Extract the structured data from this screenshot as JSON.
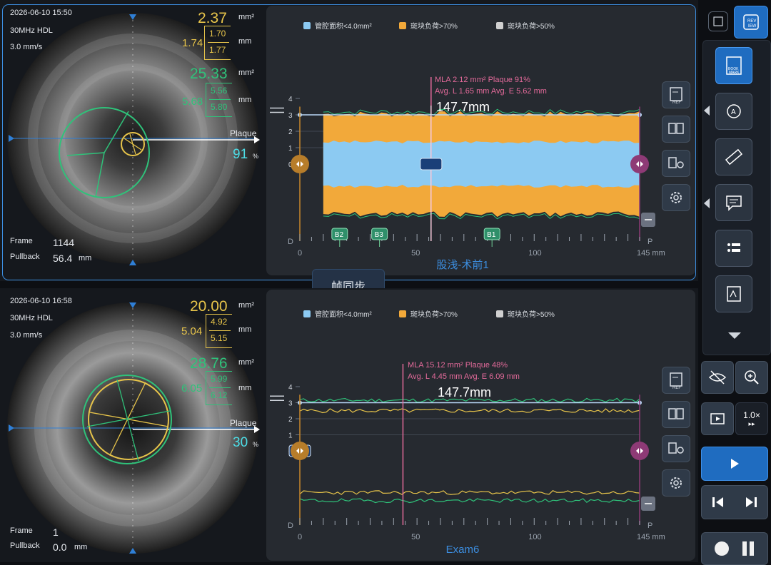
{
  "top": {
    "datetime": "2026-06-10 15:50",
    "probe": "30MHz HDL",
    "speed": "3.0 mm/s",
    "area1": "2.37",
    "area1_unit": "mm²",
    "diam1_main": "1.74",
    "diam1_top": "1.70",
    "diam1_bottom": "1.77",
    "diam1_unit": "mm",
    "area2": "25.33",
    "area2_unit": "mm²",
    "diam2_main": "5.68",
    "diam2_top": "5.56",
    "diam2_bottom": "5.80",
    "diam2_unit": "mm",
    "plaque_label": "Plaque",
    "plaque_value": "91",
    "plaque_unit": "%",
    "frame_label": "Frame",
    "frame_value": "1144",
    "pullback_label": "Pullback",
    "pullback_value": "56.4",
    "pullback_unit": "mm",
    "mla_line1": "MLA 2.12 mm²  Plaque 91%",
    "mla_line2": "Avg. L 1.65 mm  Avg. E 5.62 mm",
    "measure": "147.7mm",
    "exam_name": "股浅-术前1",
    "bookmarks": [
      "B2",
      "B3",
      "B1"
    ]
  },
  "bottom": {
    "datetime": "2026-06-10 16:58",
    "probe": "30MHz HDL",
    "speed": "3.0 mm/s",
    "area1": "20.00",
    "area1_unit": "mm²",
    "diam1_main": "5.04",
    "diam1_top": "4.92",
    "diam1_bottom": "5.15",
    "diam1_unit": "mm",
    "area2": "28.76",
    "area2_unit": "mm²",
    "diam2_main": "6.05",
    "diam2_top": "5.99",
    "diam2_bottom": "6.12",
    "diam2_unit": "mm",
    "plaque_label": "Plaque",
    "plaque_value": "30",
    "plaque_unit": "%",
    "frame_label": "Frame",
    "frame_value": "1",
    "pullback_label": "Pullback",
    "pullback_value": "0.0",
    "pullback_unit": "mm",
    "mla_line1": "MLA 15.12 mm²  Plaque 48%",
    "mla_line2": "Avg. L 4.45 mm  Avg. E 6.09 mm",
    "measure": "147.7mm",
    "exam_name": "Exam6"
  },
  "legend": {
    "item1": "管腔面积<4.0mm²",
    "item2": "斑块负荷>70%",
    "item3": "斑块负荷>50%"
  },
  "axis": {
    "y_ticks": [
      "4",
      "3",
      "2",
      "1",
      "0"
    ],
    "x_ticks": [
      "0",
      "50",
      "100",
      "145 mm"
    ],
    "left_end": "D",
    "right_end": "P"
  },
  "sync_label": "帧同步",
  "ref_label": "REF",
  "review_label": "REV\nIEW",
  "bookmark_label": "BOOK\nMARK",
  "speed_label": "1.0×",
  "colors": {
    "accent": "#3c8ee0",
    "lumen": "#8ccaf2",
    "plaque": "#f2a93a",
    "green": "#2fc27a",
    "gold": "#e7c44a",
    "pink": "#e36a9a",
    "purple": "#8e3a76"
  },
  "chart_data": [
    {
      "type": "area",
      "title": "股浅-术前1",
      "xlabel": "",
      "ylabel": "",
      "xlim": [
        0,
        145
      ],
      "ylim": [
        -4,
        4
      ],
      "x_ticks": [
        "0",
        "50",
        "100",
        "145 mm"
      ],
      "y_ticks": [
        4,
        3,
        2,
        1,
        0
      ],
      "series": [
        {
          "name": "管腔面积<4.0mm²",
          "values": [
            1.4,
            1.4,
            1.3,
            1.3,
            1.2,
            1.3,
            1.3,
            1.4,
            1.3,
            1.3,
            1.4,
            1.4
          ]
        },
        {
          "name": "斑块负荷>70%",
          "values": [
            3.1,
            3.2,
            3.3,
            3.2,
            3.1,
            3.2,
            3.3,
            3.2,
            3.1,
            3.0,
            3.0,
            3.0
          ]
        }
      ],
      "annotations": [
        "MLA 2.12 mm²  Plaque 91%",
        "Avg. L 1.65 mm  Avg. E 5.62 mm",
        "147.7mm"
      ]
    },
    {
      "type": "line",
      "title": "Exam6",
      "xlabel": "",
      "ylabel": "",
      "xlim": [
        0,
        145
      ],
      "ylim": [
        -4,
        4
      ],
      "x_ticks": [
        "0",
        "50",
        "100",
        "145 mm"
      ],
      "y_ticks": [
        4,
        3,
        2,
        1,
        0
      ],
      "annotations": [
        "MLA 15.12 mm²  Plaque 48%",
        "Avg. L 4.45 mm  Avg. E 6.09 mm",
        "147.7mm"
      ]
    }
  ]
}
